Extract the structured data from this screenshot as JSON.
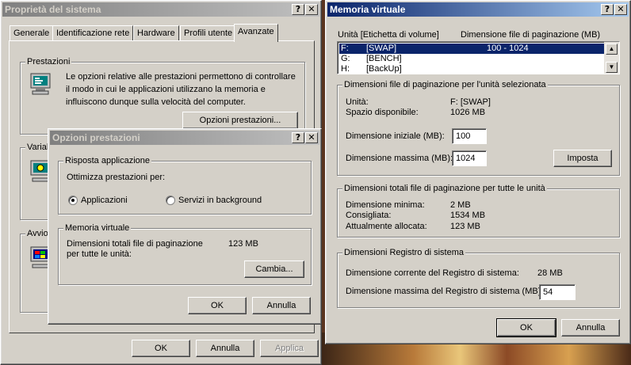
{
  "sysprops": {
    "title": "Proprietà del sistema",
    "tabs": [
      {
        "label": "Generale"
      },
      {
        "label": "Identificazione rete"
      },
      {
        "label": "Hardware"
      },
      {
        "label": "Profili utente"
      },
      {
        "label": "Avanzate"
      }
    ],
    "performance_group": "Prestazioni",
    "performance_desc": "Le opzioni relative alle prestazioni permettono di controllare il modo in cui le applicazioni utilizzano la memoria e influiscono dunque sulla velocità del computer.",
    "performance_button": "Opzioni prestazioni...",
    "env_group_partial": "Variab",
    "startup_group_partial": "Avvio",
    "ok": "OK",
    "cancel": "Annulla",
    "apply": "Applica"
  },
  "perfopts": {
    "title": "Opzioni prestazioni",
    "response_group": "Risposta applicazione",
    "optimize_label": "Ottimizza prestazioni per:",
    "radio_apps": "Applicazioni",
    "radio_bg": "Servizi in background",
    "selected": "apps",
    "vm_group": "Memoria virtuale",
    "vm_total_label": "Dimensioni totali file di paginazione per tutte le unità:",
    "vm_total_value": "123 MB",
    "change_button": "Cambia...",
    "ok": "OK",
    "cancel": "Annulla"
  },
  "vm": {
    "title": "Memoria virtuale",
    "col_drive": "Unità  [Etichetta di volume]",
    "col_size": "Dimensione file di paginazione (MB)",
    "drives": [
      {
        "letter": "F:",
        "label": "[SWAP]",
        "size": "100 - 1024",
        "selected": true
      },
      {
        "letter": "G:",
        "label": "[BENCH]",
        "size": "",
        "selected": false
      },
      {
        "letter": "H:",
        "label": "[BackUp]",
        "size": "",
        "selected": false
      }
    ],
    "sel_group": "Dimensioni file di paginazione per l'unità selezionata",
    "drive_label": "Unità:",
    "drive_value": "F:  [SWAP]",
    "free_label": "Spazio disponibile:",
    "free_value": "1026 MB",
    "initial_label": "Dimensione iniziale (MB):",
    "initial_value": "100",
    "max_label": "Dimensione massima (MB):",
    "max_value": "1024",
    "set_button": "Imposta",
    "total_group": "Dimensioni totali file di paginazione per tutte le unità",
    "min_label": "Dimensione minima:",
    "min_value": "2 MB",
    "recommended_label": "Consigliata:",
    "recommended_value": "1534 MB",
    "allocated_label": "Attualmente allocata:",
    "allocated_value": "123 MB",
    "registry_group": "Dimensioni Registro di sistema",
    "reg_current_label": "Dimensione corrente del Registro di sistema:",
    "reg_current_value": "28 MB",
    "reg_max_label": "Dimensione massima del Registro di sistema (MB):",
    "reg_max_value": "54",
    "ok": "OK",
    "cancel": "Annulla"
  },
  "titlebar_buttons": {
    "help": "?",
    "close": "✕"
  }
}
